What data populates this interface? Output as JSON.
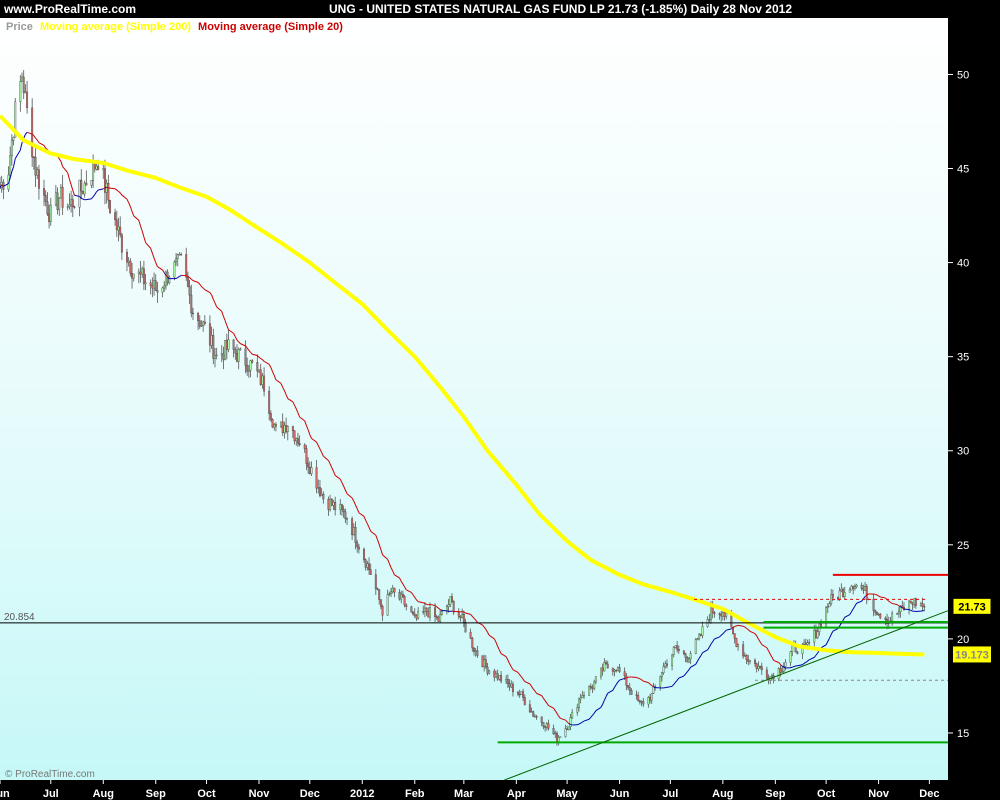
{
  "header": {
    "site": "www.ProRealTime.com",
    "title": "UNG - UNITED STATES NATURAL GAS FUND LP    21.73 (-1.85%)    Daily  28 Nov 2012"
  },
  "legend": {
    "price": "Price",
    "ma200": "Moving average (Simple 200)",
    "ma20": "Moving average (Simple 20)"
  },
  "colors": {
    "ma200": "#ffff00",
    "ma20": "#cc0000",
    "ma_blue": "#0000aa",
    "candle_up": "#aaffaa",
    "candle_down": "#d06a6a",
    "support": "#00aa00",
    "resistance": "#ee0000",
    "price_tag": "#ffff00"
  },
  "copyright": "© ProRealTime.com",
  "chart_data": {
    "type": "candlestick",
    "x_range": [
      "2011-06-01",
      "2012-12-12"
    ],
    "y_range": [
      12.5,
      53.0
    ],
    "y_ticks": [
      15,
      20,
      25,
      30,
      35,
      40,
      45,
      50
    ],
    "x_ticks": [
      {
        "label": "Jun",
        "date": "2011-06-01"
      },
      {
        "label": "Jul",
        "date": "2011-07-01"
      },
      {
        "label": "Aug",
        "date": "2011-08-01"
      },
      {
        "label": "Sep",
        "date": "2011-09-01"
      },
      {
        "label": "Oct",
        "date": "2011-10-01"
      },
      {
        "label": "Nov",
        "date": "2011-11-01"
      },
      {
        "label": "Dec",
        "date": "2011-12-01"
      },
      {
        "label": "2012",
        "date": "2012-01-01"
      },
      {
        "label": "Feb",
        "date": "2012-02-01"
      },
      {
        "label": "Mar",
        "date": "2012-03-01"
      },
      {
        "label": "Apr",
        "date": "2012-04-01"
      },
      {
        "label": "May",
        "date": "2012-05-01"
      },
      {
        "label": "Jun",
        "date": "2012-06-01"
      },
      {
        "label": "Jul",
        "date": "2012-07-01"
      },
      {
        "label": "Aug",
        "date": "2012-08-01"
      },
      {
        "label": "Sep",
        "date": "2012-09-01"
      },
      {
        "label": "Oct",
        "date": "2012-10-01"
      },
      {
        "label": "Nov",
        "date": "2012-11-01"
      },
      {
        "label": "Dec",
        "date": "2012-12-01"
      }
    ],
    "price_path": [
      [
        "2011-06-01",
        44.0
      ],
      [
        "2011-06-06",
        45.0
      ],
      [
        "2011-06-10",
        48.0
      ],
      [
        "2011-06-14",
        50.0
      ],
      [
        "2011-06-17",
        48.0
      ],
      [
        "2011-06-22",
        45.0
      ],
      [
        "2011-06-27",
        43.5
      ],
      [
        "2011-07-01",
        42.5
      ],
      [
        "2011-07-06",
        43.5
      ],
      [
        "2011-07-12",
        43.0
      ],
      [
        "2011-07-20",
        44.0
      ],
      [
        "2011-07-29",
        45.5
      ],
      [
        "2011-08-05",
        43.0
      ],
      [
        "2011-08-12",
        41.0
      ],
      [
        "2011-08-19",
        39.5
      ],
      [
        "2011-08-26",
        39.0
      ],
      [
        "2011-09-02",
        38.5
      ],
      [
        "2011-09-09",
        39.5
      ],
      [
        "2011-09-16",
        40.0
      ],
      [
        "2011-09-23",
        37.5
      ],
      [
        "2011-09-30",
        36.5
      ],
      [
        "2011-10-07",
        35.0
      ],
      [
        "2011-10-14",
        35.5
      ],
      [
        "2011-10-21",
        35.0
      ],
      [
        "2011-10-28",
        34.5
      ],
      [
        "2011-11-04",
        33.5
      ],
      [
        "2011-11-11",
        31.0
      ],
      [
        "2011-11-18",
        31.5
      ],
      [
        "2011-11-25",
        30.5
      ],
      [
        "2011-12-02",
        29.0
      ],
      [
        "2011-12-09",
        27.5
      ],
      [
        "2011-12-16",
        27.0
      ],
      [
        "2011-12-23",
        26.5
      ],
      [
        "2011-12-30",
        25.0
      ],
      [
        "2012-01-06",
        23.5
      ],
      [
        "2012-01-13",
        21.5
      ],
      [
        "2012-01-18",
        22.5
      ],
      [
        "2012-01-25",
        22.0
      ],
      [
        "2012-02-01",
        21.0
      ],
      [
        "2012-02-08",
        21.5
      ],
      [
        "2012-02-15",
        21.0
      ],
      [
        "2012-02-22",
        22.0
      ],
      [
        "2012-02-29",
        21.0
      ],
      [
        "2012-03-07",
        19.5
      ],
      [
        "2012-03-14",
        18.5
      ],
      [
        "2012-03-21",
        18.0
      ],
      [
        "2012-03-28",
        17.5
      ],
      [
        "2012-04-04",
        17.0
      ],
      [
        "2012-04-11",
        16.0
      ],
      [
        "2012-04-18",
        15.5
      ],
      [
        "2012-04-25",
        14.7
      ],
      [
        "2012-05-02",
        15.5
      ],
      [
        "2012-05-09",
        17.0
      ],
      [
        "2012-05-16",
        17.5
      ],
      [
        "2012-05-23",
        18.5
      ],
      [
        "2012-05-30",
        18.5
      ],
      [
        "2012-06-06",
        17.5
      ],
      [
        "2012-06-13",
        16.5
      ],
      [
        "2012-06-20",
        17.0
      ],
      [
        "2012-06-27",
        18.5
      ],
      [
        "2012-07-04",
        19.5
      ],
      [
        "2012-07-11",
        19.0
      ],
      [
        "2012-07-18",
        20.0
      ],
      [
        "2012-07-25",
        21.5
      ],
      [
        "2012-08-01",
        21.5
      ],
      [
        "2012-08-08",
        20.0
      ],
      [
        "2012-08-15",
        19.0
      ],
      [
        "2012-08-22",
        18.5
      ],
      [
        "2012-08-29",
        18.0
      ],
      [
        "2012-09-05",
        18.5
      ],
      [
        "2012-09-12",
        19.5
      ],
      [
        "2012-09-19",
        19.5
      ],
      [
        "2012-09-26",
        20.5
      ],
      [
        "2012-10-03",
        22.0
      ],
      [
        "2012-10-10",
        22.5
      ],
      [
        "2012-10-17",
        23.0
      ],
      [
        "2012-10-24",
        22.5
      ],
      [
        "2012-10-31",
        21.5
      ],
      [
        "2012-11-07",
        21.0
      ],
      [
        "2012-11-14",
        21.5
      ],
      [
        "2012-11-21",
        22.0
      ],
      [
        "2012-11-28",
        21.73
      ]
    ],
    "ma200": [
      [
        "2011-06-01",
        47.8
      ],
      [
        "2011-06-15",
        46.5
      ],
      [
        "2011-07-01",
        45.8
      ],
      [
        "2011-07-15",
        45.5
      ],
      [
        "2011-08-01",
        45.3
      ],
      [
        "2011-08-15",
        44.9
      ],
      [
        "2011-09-01",
        44.5
      ],
      [
        "2011-09-15",
        44.0
      ],
      [
        "2011-10-01",
        43.5
      ],
      [
        "2011-10-15",
        42.8
      ],
      [
        "2011-11-01",
        41.8
      ],
      [
        "2011-11-15",
        41.0
      ],
      [
        "2011-12-01",
        40.0
      ],
      [
        "2011-12-15",
        39.0
      ],
      [
        "2012-01-01",
        37.8
      ],
      [
        "2012-01-15",
        36.5
      ],
      [
        "2012-02-01",
        35.0
      ],
      [
        "2012-02-15",
        33.5
      ],
      [
        "2012-03-01",
        31.8
      ],
      [
        "2012-03-15",
        30.0
      ],
      [
        "2012-04-01",
        28.2
      ],
      [
        "2012-04-15",
        26.6
      ],
      [
        "2012-05-01",
        25.2
      ],
      [
        "2012-05-15",
        24.2
      ],
      [
        "2012-06-01",
        23.4
      ],
      [
        "2012-06-15",
        22.9
      ],
      [
        "2012-07-01",
        22.5
      ],
      [
        "2012-07-15",
        22.1
      ],
      [
        "2012-08-01",
        21.6
      ],
      [
        "2012-08-15",
        20.9
      ],
      [
        "2012-09-01",
        20.1
      ],
      [
        "2012-09-15",
        19.6
      ],
      [
        "2012-10-01",
        19.4
      ],
      [
        "2012-10-15",
        19.3
      ],
      [
        "2012-11-01",
        19.25
      ],
      [
        "2012-11-15",
        19.2
      ],
      [
        "2012-11-28",
        19.17
      ]
    ],
    "horizontal_lines": [
      {
        "name": "resistance",
        "y": 23.4,
        "x_from": "2012-10-05",
        "x_to": "2012-12-12",
        "color": "resistance",
        "style": "solid"
      },
      {
        "name": "dashed-upper",
        "y": 22.1,
        "x_from": "2012-07-15",
        "x_to": "2012-11-30",
        "color": "resistance",
        "style": "dashed"
      },
      {
        "name": "reference",
        "y": 20.854,
        "x_from": "2011-06-01",
        "x_to": "2012-12-12",
        "color": "#000000",
        "style": "solid",
        "label": "20.854"
      },
      {
        "name": "support-1",
        "y": 20.9,
        "x_from": "2012-08-25",
        "x_to": "2012-12-12",
        "color": "support",
        "style": "solid"
      },
      {
        "name": "support-2",
        "y": 20.6,
        "x_from": "2012-08-25",
        "x_to": "2012-12-12",
        "color": "support",
        "style": "solid"
      },
      {
        "name": "dashed-lower",
        "y": 17.8,
        "x_from": "2012-08-20",
        "x_to": "2012-12-12",
        "color": "#888888",
        "style": "dashed"
      },
      {
        "name": "support-low",
        "y": 14.5,
        "x_from": "2012-03-21",
        "x_to": "2012-12-12",
        "color": "support",
        "style": "solid"
      }
    ],
    "trendline": {
      "from": [
        "2012-03-25",
        12.5
      ],
      "to": [
        "2012-12-12",
        21.5
      ],
      "color": "#006600"
    },
    "price_tags": [
      {
        "label": "21.73",
        "y": 21.73
      },
      {
        "label": "19.173",
        "y": 19.173
      }
    ]
  }
}
